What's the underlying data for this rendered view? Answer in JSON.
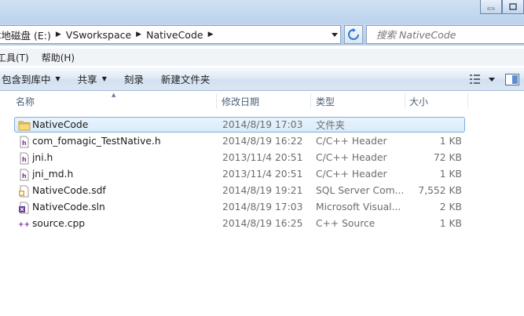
{
  "address": {
    "crumbs": [
      "本地磁盘 (E:)",
      "VSworkspace",
      "NativeCode"
    ],
    "search_placeholder": "搜索 NativeCode"
  },
  "menu": [
    "工具(T)",
    "帮助(H)"
  ],
  "commands": [
    {
      "label": "包含到库中",
      "has_dropdown": true
    },
    {
      "label": "共享",
      "has_dropdown": true
    },
    {
      "label": "刻录",
      "has_dropdown": false
    },
    {
      "label": "新建文件夹",
      "has_dropdown": false
    }
  ],
  "columns": {
    "name": "名称",
    "date": "修改日期",
    "type": "类型",
    "size": "大小"
  },
  "files": [
    {
      "name": "NativeCode",
      "date": "2014/8/19 17:03",
      "type": "文件夹",
      "size": "",
      "icon": "folder-icon",
      "selected": true
    },
    {
      "name": "com_fomagic_TestNative.h",
      "date": "2014/8/19 16:22",
      "type": "C/C++ Header",
      "size": "1 KB",
      "icon": "header-file-icon",
      "selected": false
    },
    {
      "name": "jni.h",
      "date": "2013/11/4 20:51",
      "type": "C/C++ Header",
      "size": "72 KB",
      "icon": "header-file-icon",
      "selected": false
    },
    {
      "name": "jni_md.h",
      "date": "2013/11/4 20:51",
      "type": "C/C++ Header",
      "size": "1 KB",
      "icon": "header-file-icon",
      "selected": false
    },
    {
      "name": "NativeCode.sdf",
      "date": "2014/8/19 19:21",
      "type": "SQL Server Com...",
      "size": "7,552 KB",
      "icon": "sql-file-icon",
      "selected": false
    },
    {
      "name": "NativeCode.sln",
      "date": "2014/8/19 17:03",
      "type": "Microsoft Visual...",
      "size": "2 KB",
      "icon": "visual-studio-solution-icon",
      "selected": false
    },
    {
      "name": "source.cpp",
      "date": "2014/8/19 16:25",
      "type": "C++ Source",
      "size": "1 KB",
      "icon": "cpp-file-icon",
      "selected": false
    }
  ]
}
